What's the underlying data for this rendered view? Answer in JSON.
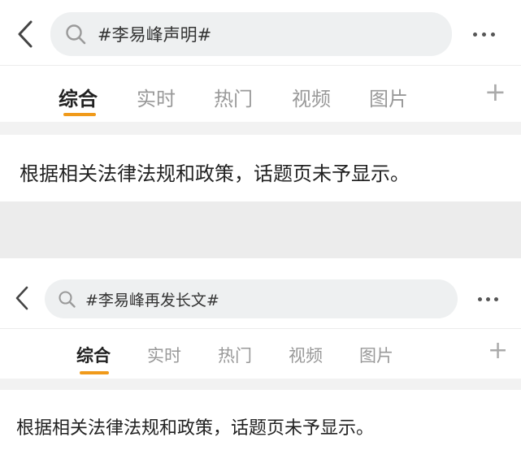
{
  "screens": [
    {
      "search": {
        "query": "#李易峰声明#"
      },
      "tabs": [
        "综合",
        "实时",
        "热门",
        "视频",
        "图片"
      ],
      "active_tab": "综合",
      "add_tab_label": "+",
      "notice": "根据相关法律法规和政策，话题页未予显示。"
    },
    {
      "search": {
        "query": "#李易峰再发长文#"
      },
      "tabs": [
        "综合",
        "实时",
        "热门",
        "视频",
        "图片"
      ],
      "active_tab": "综合",
      "add_tab_label": "+",
      "notice": "根据相关法律法规和政策，话题页未予显示。"
    }
  ],
  "colors": {
    "accent_underline": "#f09a1a",
    "search_bg": "#eef0f1",
    "inactive_tab": "#999999",
    "active_tab": "#222222"
  },
  "icons": {
    "back": "chevron-left-icon",
    "search": "magnifier-icon",
    "more": "ellipsis-icon"
  }
}
